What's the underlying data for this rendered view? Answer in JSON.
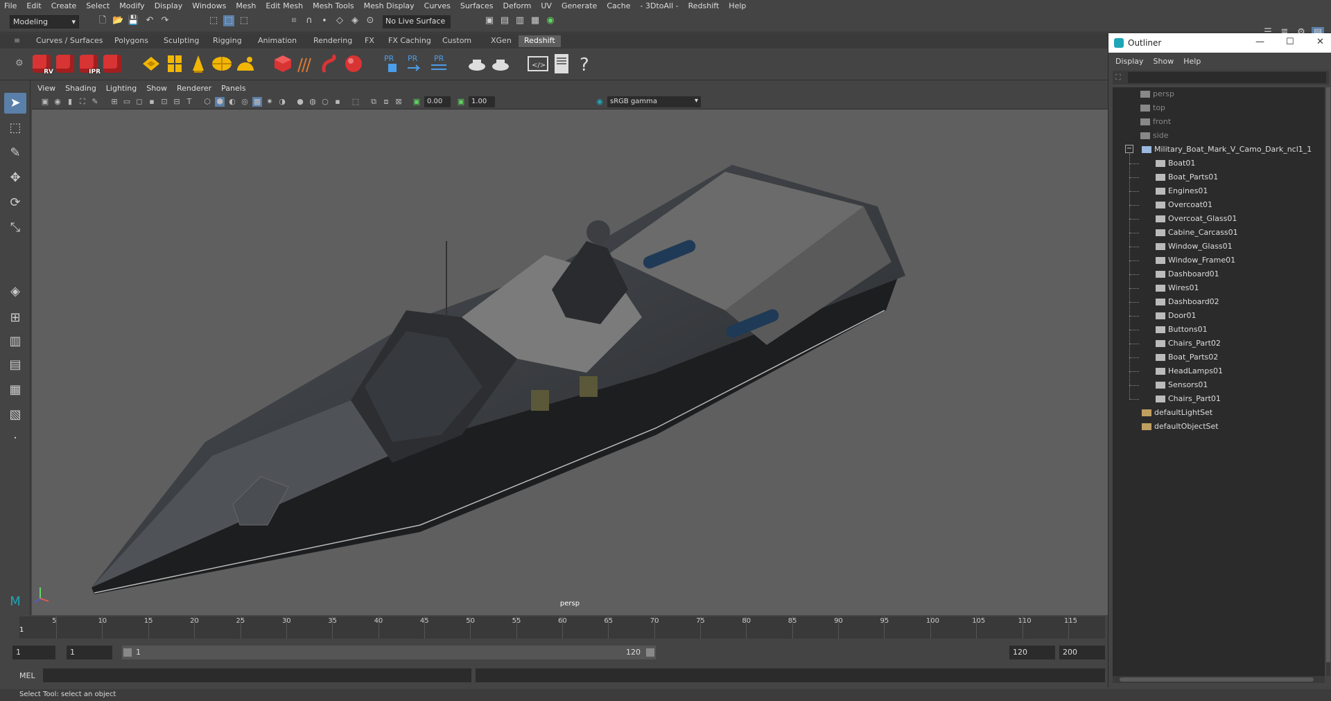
{
  "menubar": [
    "File",
    "Edit",
    "Create",
    "Select",
    "Modify",
    "Display",
    "Windows",
    "Mesh",
    "Edit Mesh",
    "Mesh Tools",
    "Mesh Display",
    "Curves",
    "Surfaces",
    "Deform",
    "UV",
    "Generate",
    "Cache",
    "- 3DtoAll -",
    "Redshift",
    "Help"
  ],
  "statusline": {
    "mode": "Modeling",
    "live_surface": "No Live Surface"
  },
  "shelf_tabs": [
    "Curves / Surfaces",
    "Polygons",
    "Sculpting",
    "Rigging",
    "Animation",
    "Rendering",
    "FX",
    "FX Caching",
    "Custom",
    "XGen",
    "Redshift"
  ],
  "active_shelf_tab": "Redshift",
  "shelf_icons": [
    {
      "name": "rs-render-view",
      "badge": "RV"
    },
    {
      "name": "rs-render",
      "badge": ""
    },
    {
      "name": "rs-ipr",
      "badge": "IPR"
    },
    {
      "name": "rs-settings",
      "badge": ""
    }
  ],
  "panel_menu": [
    "View",
    "Shading",
    "Lighting",
    "Show",
    "Renderer",
    "Panels"
  ],
  "panel_toolbar": {
    "exposure": "0.00",
    "gamma": "1.00",
    "color_space": "sRGB gamma"
  },
  "viewport": {
    "camera": "persp"
  },
  "timeslider": {
    "ticks": [
      5,
      10,
      15,
      20,
      25,
      30,
      35,
      40,
      45,
      50,
      55,
      60,
      65,
      70,
      75,
      80,
      85,
      90,
      95,
      100,
      105,
      110,
      115
    ],
    "current_frame": "1"
  },
  "range": {
    "start_time": "1",
    "playback_start": "1",
    "slider_start": "1",
    "slider_end": "120",
    "playback_end": "120",
    "end_time": "200"
  },
  "command_line": {
    "language": "MEL"
  },
  "help_line": "Select Tool: select an object",
  "outliner": {
    "title": "Outliner",
    "menu": [
      "Display",
      "Show",
      "Help"
    ],
    "cameras": [
      "persp",
      "top",
      "front",
      "side"
    ],
    "root": "Military_Boat_Mark_V_Camo_Dark_ncl1_1",
    "children": [
      "Boat01",
      "Boat_Parts01",
      "Engines01",
      "Overcoat01",
      "Overcoat_Glass01",
      "Cabine_Carcass01",
      "Window_Glass01",
      "Window_Frame01",
      "Dashboard01",
      "Wires01",
      "Dashboard02",
      "Door01",
      "Buttons01",
      "Chairs_Part02",
      "Boat_Parts02",
      "HeadLamps01",
      "Sensors01",
      "Chairs_Part01"
    ],
    "sets": [
      "defaultLightSet",
      "defaultObjectSet"
    ]
  },
  "colors": {
    "accent": "#5a7fa8",
    "redshift": "#d93434",
    "viewport_bg": "#5f5f5f"
  }
}
